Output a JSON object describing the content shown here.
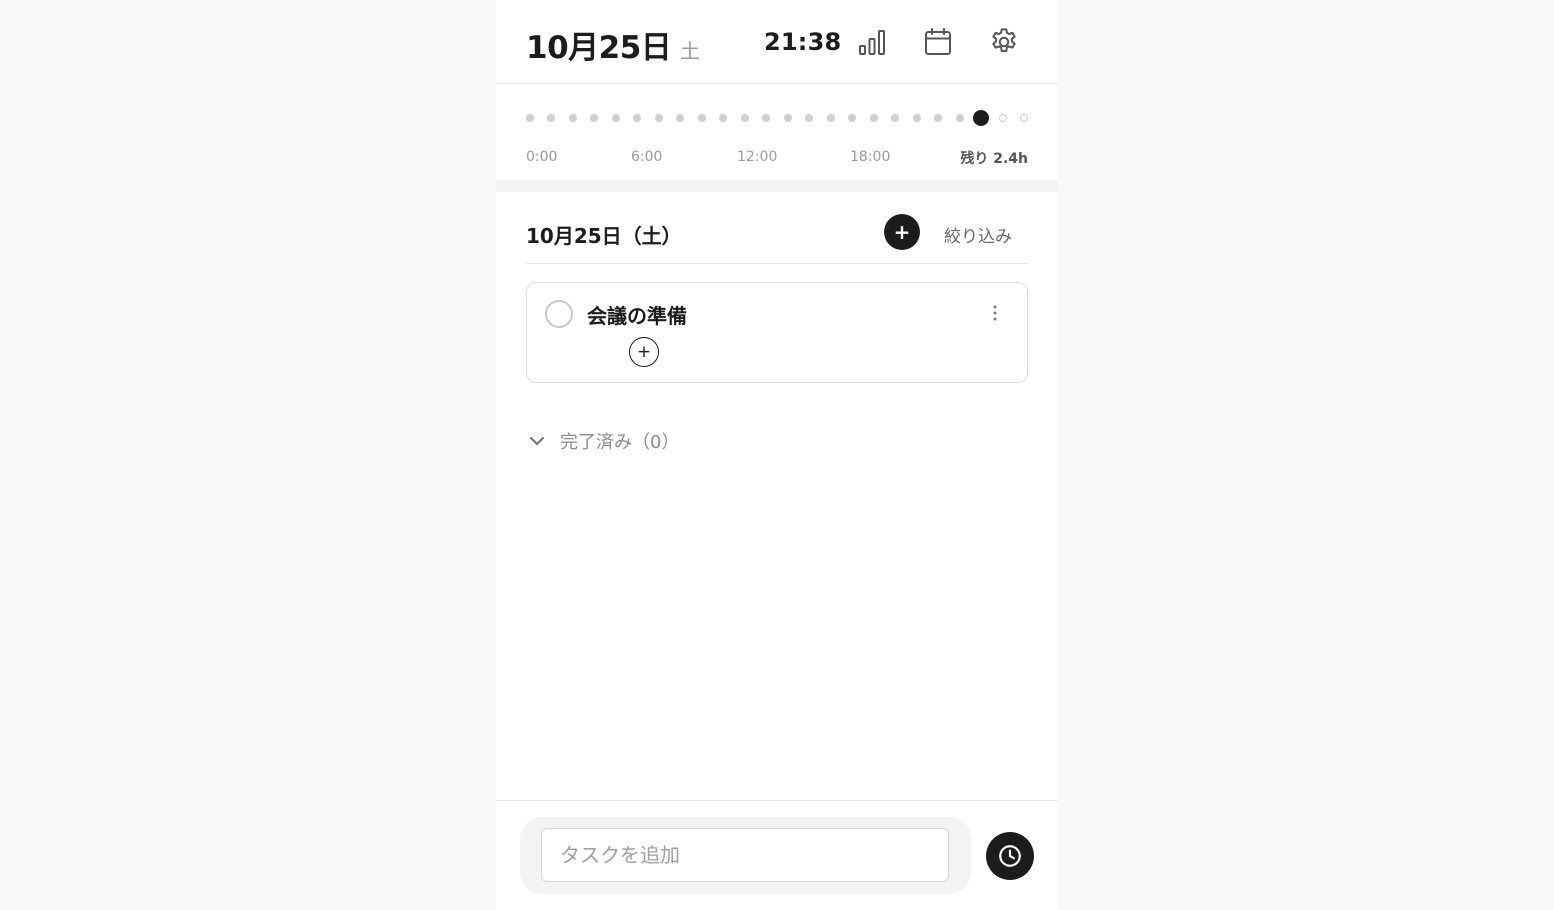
{
  "header": {
    "date": "10月25日",
    "weekday": "土",
    "time": "21:38",
    "icons": [
      "stats-icon",
      "calendar-icon",
      "settings-gear-icon"
    ]
  },
  "timeline": {
    "hours_total": 24,
    "current_hour": 21,
    "tick_labels": [
      "0:00",
      "6:00",
      "12:00",
      "18:00"
    ],
    "remaining": "残り 2.4h"
  },
  "list": {
    "date_heading": "10月25日（土）",
    "add_label": "+",
    "filter_label": "絞り込み"
  },
  "tasks": [
    {
      "title": "会議の準備",
      "done": false,
      "subtask_add_label": "+"
    }
  ],
  "completed": {
    "label": "完了済み（0）"
  },
  "footer": {
    "input_placeholder": "タスクを追加",
    "input_value": ""
  },
  "colors": {
    "accent": "#1c1c1c",
    "muted": "#9a9a9a",
    "dot": "#cfcfcf"
  }
}
